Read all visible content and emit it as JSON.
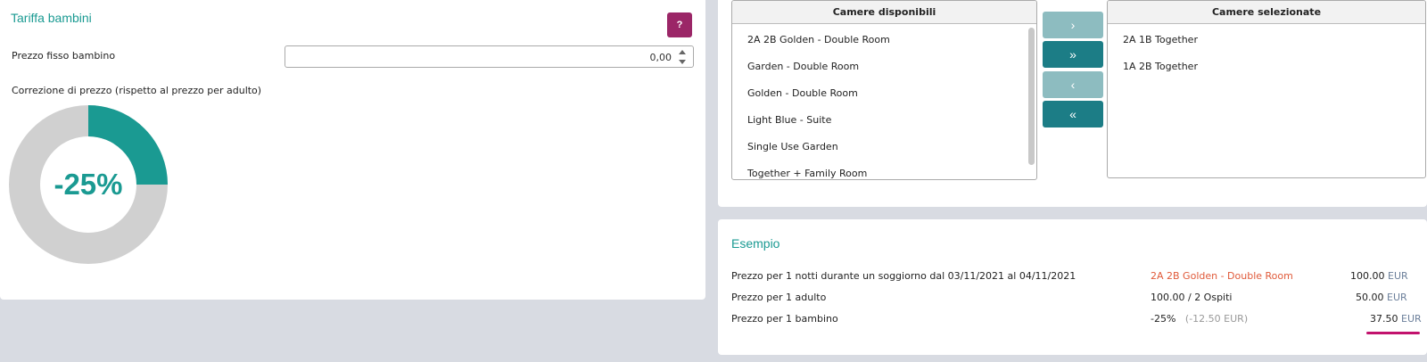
{
  "child_rate": {
    "title": "Tariffa bambini",
    "help_label": "?",
    "fixed_price_label": "Prezzo fisso bambino",
    "fixed_price_value": "0,00",
    "correction_label": "Correzione di prezzo (rispetto al prezzo per adulto)",
    "donut": {
      "percent_text": "-25%",
      "fraction": 0.25,
      "fill_color": "#1a9a92",
      "track_color": "#d0d0d0"
    }
  },
  "rooms": {
    "available_header": "Camere disponibili",
    "available": [
      "2A 2B Golden - Double Room",
      "Garden - Double Room",
      "Golden - Double Room",
      "Light Blue - Suite",
      "Single Use Garden",
      "Together + Family Room"
    ],
    "selected_header": "Camere selezionate",
    "selected": [
      "2A 1B Together",
      "1A 2B Together"
    ],
    "buttons": {
      "move_one_right": "›",
      "move_all_right": "»",
      "move_one_left": "‹",
      "move_all_left": "«"
    }
  },
  "example": {
    "title": "Esempio",
    "rows": [
      {
        "label": "Prezzo per 1 notti durante un soggiorno dal 03/11/2021 al 04/11/2021",
        "detail": "2A 2B Golden - Double Room",
        "detail_extra": "",
        "amount": "100.00",
        "currency": "EUR"
      },
      {
        "label": "Prezzo per 1 adulto",
        "detail": "100.00 / 2 Ospiti",
        "detail_extra": "",
        "amount": "50.00",
        "currency": "EUR"
      },
      {
        "label": "Prezzo per 1 bambino",
        "detail": "-25%",
        "detail_extra": "(-12.50 EUR)",
        "amount": "37.50",
        "currency": "EUR"
      }
    ]
  },
  "colors": {
    "accent": "#1a9a92",
    "help_button": "#9b2667",
    "room_highlight": "#e05a3a",
    "underline": "#c2126d"
  }
}
